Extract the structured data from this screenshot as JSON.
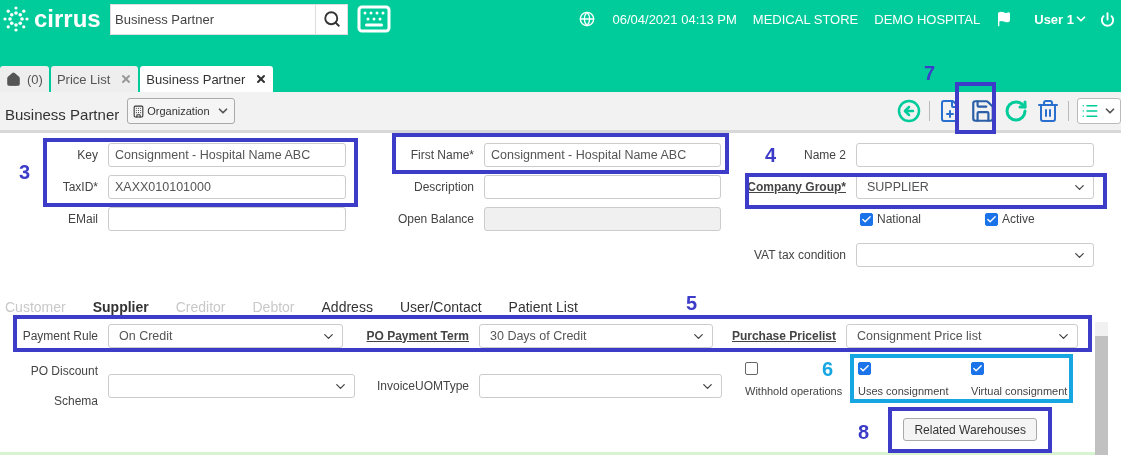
{
  "header": {
    "logo": "cirrus",
    "search": {
      "value": "Business Partner"
    },
    "date_time": "06/04/2021 04:13 PM",
    "store": "MEDICAL STORE",
    "hospital": "DEMO HOSPITAL",
    "user": "User 1"
  },
  "tabs": [
    {
      "kind": "home",
      "label": "(0)",
      "selected": false
    },
    {
      "kind": "page",
      "label": "Price List",
      "selected": false
    },
    {
      "kind": "page",
      "label": "Business Partner",
      "selected": true
    }
  ],
  "toolbar": {
    "title": "Business Partner",
    "organization": "Organization"
  },
  "top_columns": [
    [
      {
        "kind": "input",
        "label": "Key",
        "value": "Consignment - Hospital Name ABC"
      },
      {
        "kind": "input",
        "label": "TaxID*",
        "value": "XAXX010101000"
      },
      {
        "kind": "input",
        "label": "EMail"
      }
    ],
    [
      {
        "kind": "input",
        "label": "First Name*",
        "value": "Consignment - Hospital Name ABC"
      },
      {
        "kind": "input",
        "label": "Description"
      },
      {
        "kind": "input",
        "label": "Open Balance",
        "disabled": true
      }
    ],
    [
      {
        "kind": "input",
        "label": "Name 2"
      },
      {
        "kind": "select",
        "label": "Company Group*",
        "value": "SUPPLIER",
        "link": true
      },
      {
        "kind": "checks",
        "items": [
          {
            "label": "National",
            "checked": true
          },
          {
            "label": "Active",
            "checked": true
          }
        ]
      },
      {
        "kind": "select",
        "label": "VAT tax condition"
      }
    ]
  ],
  "section_tabs": [
    {
      "label": "Customer",
      "selected": false,
      "disabled": true
    },
    {
      "label": "Supplier",
      "selected": true,
      "disabled": false
    },
    {
      "label": "Creditor",
      "selected": false,
      "disabled": true
    },
    {
      "label": "Debtor",
      "selected": false,
      "disabled": true
    },
    {
      "label": "Address",
      "selected": false,
      "disabled": false
    },
    {
      "label": "User/Contact",
      "selected": false,
      "disabled": false
    },
    {
      "label": "Patient List",
      "selected": false,
      "disabled": false
    }
  ],
  "supplier_rows": [
    [
      {
        "kind": "select",
        "label": "Payment Rule",
        "value": "On Credit"
      },
      {
        "kind": "select",
        "label": "PO Payment Term",
        "value": "30 Days of Credit",
        "link": true
      },
      {
        "kind": "select",
        "label": "Purchase Pricelist",
        "value": "Consignment Price list",
        "link": true
      }
    ],
    [
      {
        "kind": "select",
        "label": "PO Discount Schema"
      },
      {
        "kind": "select",
        "label": "InvoiceUOMType"
      },
      {
        "kind": "checks",
        "items": [
          {
            "label": "Withhold operations",
            "checked": false
          },
          {
            "label": "Uses consignment",
            "checked": true
          },
          {
            "label": "Virtual consignment",
            "checked": true
          }
        ]
      }
    ]
  ],
  "action_button": "Related Warehouses",
  "annotations": [
    {
      "number": "7",
      "color": "#3c3cc8"
    },
    {
      "color": "#3c3cc8"
    },
    {
      "number": "3",
      "color": "#3c3cc8"
    },
    {
      "number": "4",
      "color": "#3c3cc8"
    },
    {
      "number": "5",
      "color": "#3c3cc8"
    },
    {
      "number": "6",
      "color": "#16a6e2"
    },
    {
      "number": "8",
      "color": "#3c3cc8"
    }
  ]
}
